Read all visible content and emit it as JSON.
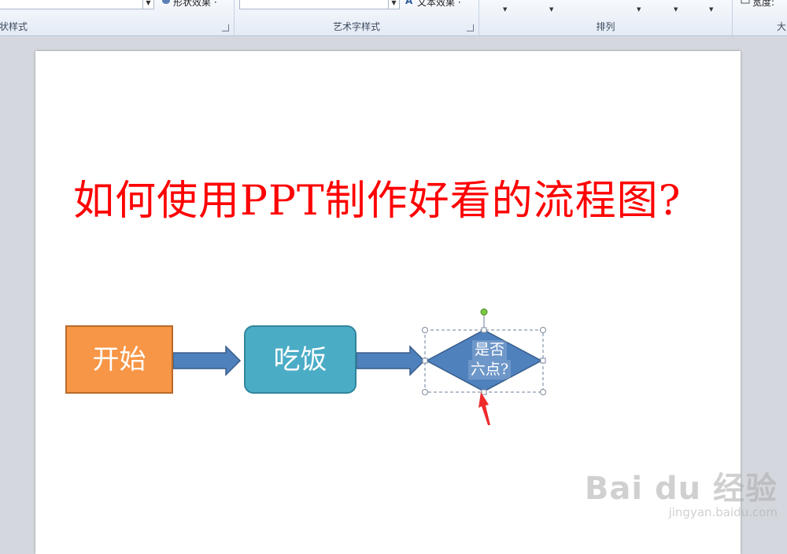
{
  "ribbon": {
    "groups": {
      "shape_styles": {
        "label": "状样式",
        "effects_button": "形状效果 ·"
      },
      "wordart": {
        "label": "艺术字样式",
        "effects_button": "文本效果 ·"
      },
      "arrange": {
        "label": "排列"
      },
      "size": {
        "label": "大",
        "width_label": "宽度: "
      }
    }
  },
  "slide": {
    "title": "如何使用PPT制作好看的流程图?",
    "title_color": "#ff0000",
    "flow": {
      "start": {
        "label": "开始",
        "fill": "#f79646"
      },
      "eat": {
        "label": "吃饭",
        "fill": "#4bacc6"
      },
      "decision": {
        "line1": "是否",
        "line2": "六点?",
        "fill": "#4f81bd"
      },
      "arrow_fill": "#4f81bd"
    }
  },
  "watermark": {
    "brand": "Bai du 经验",
    "url": "jingyan.baidu.com"
  }
}
